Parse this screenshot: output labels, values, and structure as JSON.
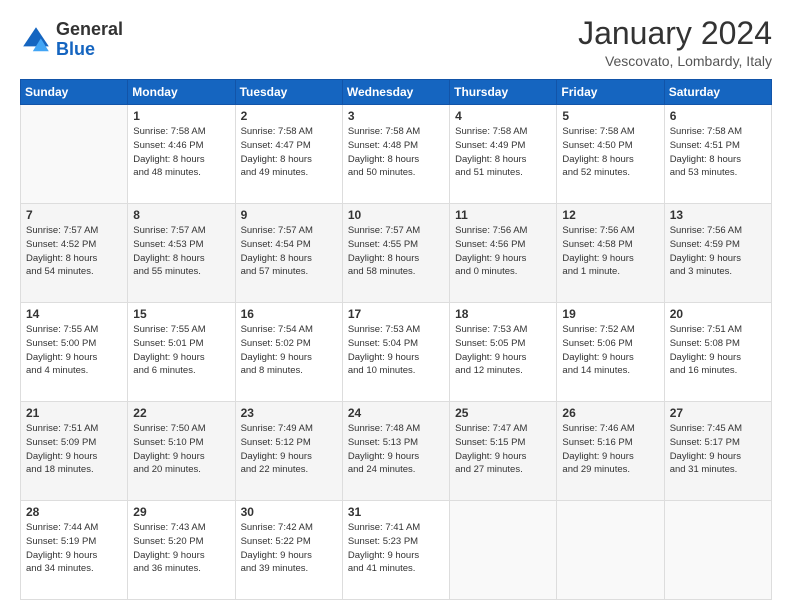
{
  "logo": {
    "general": "General",
    "blue": "Blue"
  },
  "header": {
    "title": "January 2024",
    "location": "Vescovato, Lombardy, Italy"
  },
  "weekdays": [
    "Sunday",
    "Monday",
    "Tuesday",
    "Wednesday",
    "Thursday",
    "Friday",
    "Saturday"
  ],
  "weeks": [
    [
      {
        "day": "",
        "info": ""
      },
      {
        "day": "1",
        "info": "Sunrise: 7:58 AM\nSunset: 4:46 PM\nDaylight: 8 hours\nand 48 minutes."
      },
      {
        "day": "2",
        "info": "Sunrise: 7:58 AM\nSunset: 4:47 PM\nDaylight: 8 hours\nand 49 minutes."
      },
      {
        "day": "3",
        "info": "Sunrise: 7:58 AM\nSunset: 4:48 PM\nDaylight: 8 hours\nand 50 minutes."
      },
      {
        "day": "4",
        "info": "Sunrise: 7:58 AM\nSunset: 4:49 PM\nDaylight: 8 hours\nand 51 minutes."
      },
      {
        "day": "5",
        "info": "Sunrise: 7:58 AM\nSunset: 4:50 PM\nDaylight: 8 hours\nand 52 minutes."
      },
      {
        "day": "6",
        "info": "Sunrise: 7:58 AM\nSunset: 4:51 PM\nDaylight: 8 hours\nand 53 minutes."
      }
    ],
    [
      {
        "day": "7",
        "info": "Sunrise: 7:57 AM\nSunset: 4:52 PM\nDaylight: 8 hours\nand 54 minutes."
      },
      {
        "day": "8",
        "info": "Sunrise: 7:57 AM\nSunset: 4:53 PM\nDaylight: 8 hours\nand 55 minutes."
      },
      {
        "day": "9",
        "info": "Sunrise: 7:57 AM\nSunset: 4:54 PM\nDaylight: 8 hours\nand 57 minutes."
      },
      {
        "day": "10",
        "info": "Sunrise: 7:57 AM\nSunset: 4:55 PM\nDaylight: 8 hours\nand 58 minutes."
      },
      {
        "day": "11",
        "info": "Sunrise: 7:56 AM\nSunset: 4:56 PM\nDaylight: 9 hours\nand 0 minutes."
      },
      {
        "day": "12",
        "info": "Sunrise: 7:56 AM\nSunset: 4:58 PM\nDaylight: 9 hours\nand 1 minute."
      },
      {
        "day": "13",
        "info": "Sunrise: 7:56 AM\nSunset: 4:59 PM\nDaylight: 9 hours\nand 3 minutes."
      }
    ],
    [
      {
        "day": "14",
        "info": "Sunrise: 7:55 AM\nSunset: 5:00 PM\nDaylight: 9 hours\nand 4 minutes."
      },
      {
        "day": "15",
        "info": "Sunrise: 7:55 AM\nSunset: 5:01 PM\nDaylight: 9 hours\nand 6 minutes."
      },
      {
        "day": "16",
        "info": "Sunrise: 7:54 AM\nSunset: 5:02 PM\nDaylight: 9 hours\nand 8 minutes."
      },
      {
        "day": "17",
        "info": "Sunrise: 7:53 AM\nSunset: 5:04 PM\nDaylight: 9 hours\nand 10 minutes."
      },
      {
        "day": "18",
        "info": "Sunrise: 7:53 AM\nSunset: 5:05 PM\nDaylight: 9 hours\nand 12 minutes."
      },
      {
        "day": "19",
        "info": "Sunrise: 7:52 AM\nSunset: 5:06 PM\nDaylight: 9 hours\nand 14 minutes."
      },
      {
        "day": "20",
        "info": "Sunrise: 7:51 AM\nSunset: 5:08 PM\nDaylight: 9 hours\nand 16 minutes."
      }
    ],
    [
      {
        "day": "21",
        "info": "Sunrise: 7:51 AM\nSunset: 5:09 PM\nDaylight: 9 hours\nand 18 minutes."
      },
      {
        "day": "22",
        "info": "Sunrise: 7:50 AM\nSunset: 5:10 PM\nDaylight: 9 hours\nand 20 minutes."
      },
      {
        "day": "23",
        "info": "Sunrise: 7:49 AM\nSunset: 5:12 PM\nDaylight: 9 hours\nand 22 minutes."
      },
      {
        "day": "24",
        "info": "Sunrise: 7:48 AM\nSunset: 5:13 PM\nDaylight: 9 hours\nand 24 minutes."
      },
      {
        "day": "25",
        "info": "Sunrise: 7:47 AM\nSunset: 5:15 PM\nDaylight: 9 hours\nand 27 minutes."
      },
      {
        "day": "26",
        "info": "Sunrise: 7:46 AM\nSunset: 5:16 PM\nDaylight: 9 hours\nand 29 minutes."
      },
      {
        "day": "27",
        "info": "Sunrise: 7:45 AM\nSunset: 5:17 PM\nDaylight: 9 hours\nand 31 minutes."
      }
    ],
    [
      {
        "day": "28",
        "info": "Sunrise: 7:44 AM\nSunset: 5:19 PM\nDaylight: 9 hours\nand 34 minutes."
      },
      {
        "day": "29",
        "info": "Sunrise: 7:43 AM\nSunset: 5:20 PM\nDaylight: 9 hours\nand 36 minutes."
      },
      {
        "day": "30",
        "info": "Sunrise: 7:42 AM\nSunset: 5:22 PM\nDaylight: 9 hours\nand 39 minutes."
      },
      {
        "day": "31",
        "info": "Sunrise: 7:41 AM\nSunset: 5:23 PM\nDaylight: 9 hours\nand 41 minutes."
      },
      {
        "day": "",
        "info": ""
      },
      {
        "day": "",
        "info": ""
      },
      {
        "day": "",
        "info": ""
      }
    ]
  ]
}
